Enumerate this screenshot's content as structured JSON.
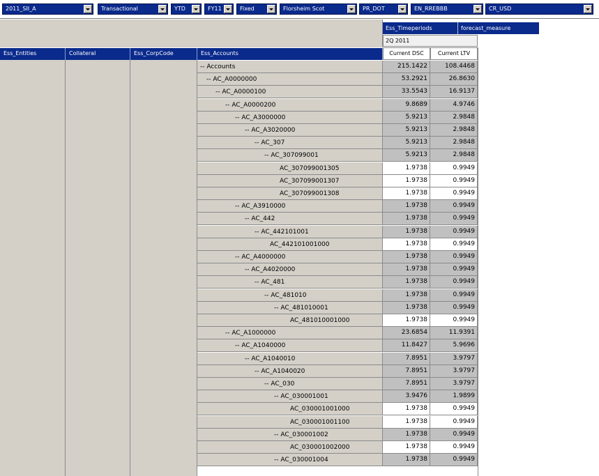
{
  "pov": [
    {
      "label": "2011_SII_A"
    },
    {
      "label": "Transactional"
    },
    {
      "label": "YTD"
    },
    {
      "label": "FY11"
    },
    {
      "label": "Fixed"
    },
    {
      "label": "Florsheim Scot"
    },
    {
      "label": "PR_DOT"
    },
    {
      "label": "EN_RREBBB"
    },
    {
      "label": "CR_USD"
    }
  ],
  "column_dims": {
    "timeperiods": "Ess_Timeperiods",
    "measure": "forecast_measure"
  },
  "period": "2Q 2011",
  "measures": [
    "Current DSC",
    "Current LTV"
  ],
  "row_dims": [
    "Ess_Entities",
    "Collateral",
    "Ess_CorpCode",
    "Ess_Accounts"
  ],
  "rows": [
    {
      "label": "-- Accounts",
      "dsc": "215.1422",
      "ltv": "108.4468",
      "shade": "g"
    },
    {
      "label": "-- AC_A0000000",
      "dsc": "53.2921",
      "ltv": "26.8630",
      "shade": "g"
    },
    {
      "label": "-- AC_A0000100",
      "dsc": "33.5543",
      "ltv": "16.9137",
      "shade": "g"
    },
    {
      "label": "-- AC_A0000200",
      "dsc": "9.8689",
      "ltv": "4.9746",
      "shade": "g"
    },
    {
      "label": "-- AC_A3000000",
      "dsc": "5.9213",
      "ltv": "2.9848",
      "shade": "g"
    },
    {
      "label": "-- AC_A3020000",
      "dsc": "5.9213",
      "ltv": "2.9848",
      "shade": "g"
    },
    {
      "label": "-- AC_307",
      "dsc": "5.9213",
      "ltv": "2.9848",
      "shade": "g"
    },
    {
      "label": "-- AC_307099001",
      "dsc": "5.9213",
      "ltv": "2.9848",
      "shade": "g"
    },
    {
      "label": "AC_307099001305",
      "dsc": "1.9738",
      "ltv": "0.9949",
      "shade": "w"
    },
    {
      "label": "AC_307099001307",
      "dsc": "1.9738",
      "ltv": "0.9949",
      "shade": "w"
    },
    {
      "label": "AC_307099001308",
      "dsc": "1.9738",
      "ltv": "0.9949",
      "shade": "w"
    },
    {
      "label": "-- AC_A3910000",
      "dsc": "1.9738",
      "ltv": "0.9949",
      "shade": "g"
    },
    {
      "label": "-- AC_442",
      "dsc": "1.9738",
      "ltv": "0.9949",
      "shade": "g"
    },
    {
      "label": "-- AC_442101001",
      "dsc": "1.9738",
      "ltv": "0.9949",
      "shade": "g"
    },
    {
      "label": "AC_442101001000",
      "dsc": "1.9738",
      "ltv": "0.9949",
      "shade": "w"
    },
    {
      "label": "-- AC_A4000000",
      "dsc": "1.9738",
      "ltv": "0.9949",
      "shade": "g"
    },
    {
      "label": "-- AC_A4020000",
      "dsc": "1.9738",
      "ltv": "0.9949",
      "shade": "g"
    },
    {
      "label": "-- AC_481",
      "dsc": "1.9738",
      "ltv": "0.9949",
      "shade": "g"
    },
    {
      "label": "-- AC_481010",
      "dsc": "1.9738",
      "ltv": "0.9949",
      "shade": "g"
    },
    {
      "label": "-- AC_481010001",
      "dsc": "1.9738",
      "ltv": "0.9949",
      "shade": "g"
    },
    {
      "label": "AC_481010001000",
      "dsc": "1.9738",
      "ltv": "0.9949",
      "shade": "w"
    },
    {
      "label": "-- AC_A1000000",
      "dsc": "23.6854",
      "ltv": "11.9391",
      "shade": "g"
    },
    {
      "label": "-- AC_A1040000",
      "dsc": "11.8427",
      "ltv": "5.9696",
      "shade": "g"
    },
    {
      "label": "-- AC_A1040010",
      "dsc": "7.8951",
      "ltv": "3.9797",
      "shade": "g"
    },
    {
      "label": "-- AC_A1040020",
      "dsc": "7.8951",
      "ltv": "3.9797",
      "shade": "g"
    },
    {
      "label": "-- AC_030",
      "dsc": "7.8951",
      "ltv": "3.9797",
      "shade": "g"
    },
    {
      "label": "-- AC_030001001",
      "dsc": "3.9476",
      "ltv": "1.9899",
      "shade": "g"
    },
    {
      "label": "AC_030001001000",
      "dsc": "1.9738",
      "ltv": "0.9949",
      "shade": "w"
    },
    {
      "label": "AC_030001001100",
      "dsc": "1.9738",
      "ltv": "0.9949",
      "shade": "w"
    },
    {
      "label": "-- AC_030001002",
      "dsc": "1.9738",
      "ltv": "0.9949",
      "shade": "g"
    },
    {
      "label": "AC_030001002000",
      "dsc": "1.9738",
      "ltv": "0.9949",
      "shade": "w"
    },
    {
      "label": "-- AC_030001004",
      "dsc": "1.9738",
      "ltv": "0.9949",
      "shade": "g"
    }
  ]
}
